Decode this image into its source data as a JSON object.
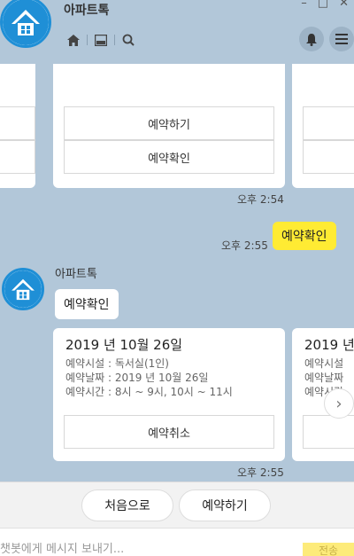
{
  "header": {
    "title": "아파트톡",
    "window_controls": [
      "–",
      "□",
      "✕"
    ],
    "icons": [
      "home-icon",
      "inbox-icon",
      "search-icon",
      "bell-icon",
      "menu-icon"
    ]
  },
  "chat": {
    "top_cards": {
      "middle": {
        "buttons": [
          "예약하기",
          "예약확인"
        ]
      }
    },
    "ts1": "오후 2:54",
    "user_bubble": "예약확인",
    "ts2": "오후 2:55",
    "bot_name": "아파트톡",
    "bot_bubble": "예약확인",
    "reservation_card": {
      "title": "2019 년 10월 26일",
      "facility": "예약시설 : 독서실(1인)",
      "date": "예약날짜 : 2019 년 10월 26일",
      "time": "예약시간 : 8시 ~ 9시, 10시 ~ 11시",
      "cancel_button": "예약취소"
    },
    "partial_card": {
      "title": "2019 년",
      "facility": "예약시설",
      "date": "예약날짜",
      "time": "예약시간"
    },
    "ts3": "오후 2:55"
  },
  "quick_replies": [
    "처음으로",
    "예약하기"
  ],
  "composer": {
    "placeholder": "챗봇에게 메시지 보내기...",
    "send_label": "전송"
  },
  "colors": {
    "header_bg": "#b2c7d9",
    "user_bubble": "#ffeb33",
    "brand_blue": "#1f8fd6"
  }
}
